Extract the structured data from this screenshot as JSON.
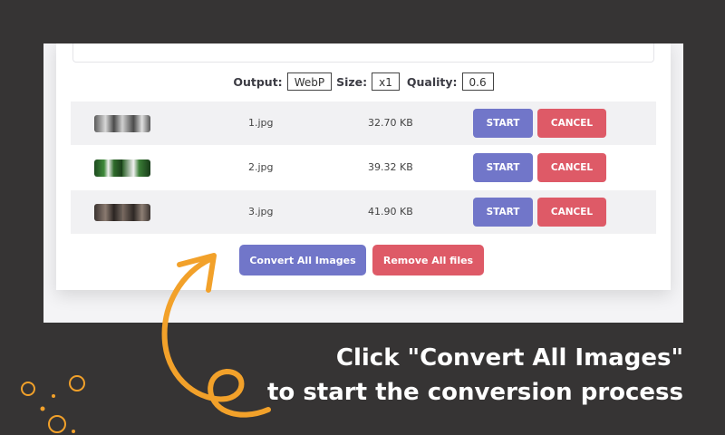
{
  "colors": {
    "background": "#363434",
    "accent_orange": "#f2a12a",
    "primary_button": "#7176c9",
    "danger_button": "#de5a67"
  },
  "options": {
    "output_label": "Output:",
    "output_value": "WebP",
    "size_label": "Size:",
    "size_value": "x1",
    "quality_label": "Quality:",
    "quality_value": "0.6"
  },
  "files": [
    {
      "name": "1.jpg",
      "size": "32.70 KB",
      "start_label": "START",
      "cancel_label": "CANCEL"
    },
    {
      "name": "2.jpg",
      "size": "39.32 KB",
      "start_label": "START",
      "cancel_label": "CANCEL"
    },
    {
      "name": "3.jpg",
      "size": "41.90 KB",
      "start_label": "START",
      "cancel_label": "CANCEL"
    }
  ],
  "actions": {
    "convert_all_label": "Convert All Images",
    "remove_all_label": "Remove All files"
  },
  "caption": {
    "line1": "Click \"Convert All Images\"",
    "line2": "to start the conversion process"
  }
}
